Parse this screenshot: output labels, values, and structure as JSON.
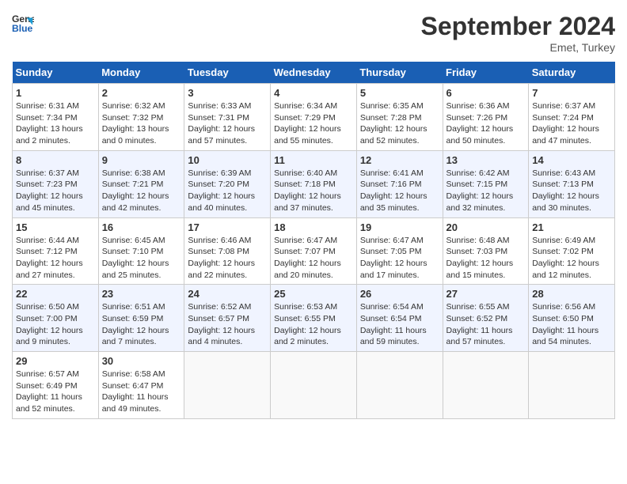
{
  "header": {
    "logo_line1": "General",
    "logo_line2": "Blue",
    "month": "September 2024",
    "location": "Emet, Turkey"
  },
  "weekdays": [
    "Sunday",
    "Monday",
    "Tuesday",
    "Wednesday",
    "Thursday",
    "Friday",
    "Saturday"
  ],
  "weeks": [
    [
      {
        "day": "1",
        "info": "Sunrise: 6:31 AM\nSunset: 7:34 PM\nDaylight: 13 hours\nand 2 minutes."
      },
      {
        "day": "2",
        "info": "Sunrise: 6:32 AM\nSunset: 7:32 PM\nDaylight: 13 hours\nand 0 minutes."
      },
      {
        "day": "3",
        "info": "Sunrise: 6:33 AM\nSunset: 7:31 PM\nDaylight: 12 hours\nand 57 minutes."
      },
      {
        "day": "4",
        "info": "Sunrise: 6:34 AM\nSunset: 7:29 PM\nDaylight: 12 hours\nand 55 minutes."
      },
      {
        "day": "5",
        "info": "Sunrise: 6:35 AM\nSunset: 7:28 PM\nDaylight: 12 hours\nand 52 minutes."
      },
      {
        "day": "6",
        "info": "Sunrise: 6:36 AM\nSunset: 7:26 PM\nDaylight: 12 hours\nand 50 minutes."
      },
      {
        "day": "7",
        "info": "Sunrise: 6:37 AM\nSunset: 7:24 PM\nDaylight: 12 hours\nand 47 minutes."
      }
    ],
    [
      {
        "day": "8",
        "info": "Sunrise: 6:37 AM\nSunset: 7:23 PM\nDaylight: 12 hours\nand 45 minutes."
      },
      {
        "day": "9",
        "info": "Sunrise: 6:38 AM\nSunset: 7:21 PM\nDaylight: 12 hours\nand 42 minutes."
      },
      {
        "day": "10",
        "info": "Sunrise: 6:39 AM\nSunset: 7:20 PM\nDaylight: 12 hours\nand 40 minutes."
      },
      {
        "day": "11",
        "info": "Sunrise: 6:40 AM\nSunset: 7:18 PM\nDaylight: 12 hours\nand 37 minutes."
      },
      {
        "day": "12",
        "info": "Sunrise: 6:41 AM\nSunset: 7:16 PM\nDaylight: 12 hours\nand 35 minutes."
      },
      {
        "day": "13",
        "info": "Sunrise: 6:42 AM\nSunset: 7:15 PM\nDaylight: 12 hours\nand 32 minutes."
      },
      {
        "day": "14",
        "info": "Sunrise: 6:43 AM\nSunset: 7:13 PM\nDaylight: 12 hours\nand 30 minutes."
      }
    ],
    [
      {
        "day": "15",
        "info": "Sunrise: 6:44 AM\nSunset: 7:12 PM\nDaylight: 12 hours\nand 27 minutes."
      },
      {
        "day": "16",
        "info": "Sunrise: 6:45 AM\nSunset: 7:10 PM\nDaylight: 12 hours\nand 25 minutes."
      },
      {
        "day": "17",
        "info": "Sunrise: 6:46 AM\nSunset: 7:08 PM\nDaylight: 12 hours\nand 22 minutes."
      },
      {
        "day": "18",
        "info": "Sunrise: 6:47 AM\nSunset: 7:07 PM\nDaylight: 12 hours\nand 20 minutes."
      },
      {
        "day": "19",
        "info": "Sunrise: 6:47 AM\nSunset: 7:05 PM\nDaylight: 12 hours\nand 17 minutes."
      },
      {
        "day": "20",
        "info": "Sunrise: 6:48 AM\nSunset: 7:03 PM\nDaylight: 12 hours\nand 15 minutes."
      },
      {
        "day": "21",
        "info": "Sunrise: 6:49 AM\nSunset: 7:02 PM\nDaylight: 12 hours\nand 12 minutes."
      }
    ],
    [
      {
        "day": "22",
        "info": "Sunrise: 6:50 AM\nSunset: 7:00 PM\nDaylight: 12 hours\nand 9 minutes."
      },
      {
        "day": "23",
        "info": "Sunrise: 6:51 AM\nSunset: 6:59 PM\nDaylight: 12 hours\nand 7 minutes."
      },
      {
        "day": "24",
        "info": "Sunrise: 6:52 AM\nSunset: 6:57 PM\nDaylight: 12 hours\nand 4 minutes."
      },
      {
        "day": "25",
        "info": "Sunrise: 6:53 AM\nSunset: 6:55 PM\nDaylight: 12 hours\nand 2 minutes."
      },
      {
        "day": "26",
        "info": "Sunrise: 6:54 AM\nSunset: 6:54 PM\nDaylight: 11 hours\nand 59 minutes."
      },
      {
        "day": "27",
        "info": "Sunrise: 6:55 AM\nSunset: 6:52 PM\nDaylight: 11 hours\nand 57 minutes."
      },
      {
        "day": "28",
        "info": "Sunrise: 6:56 AM\nSunset: 6:50 PM\nDaylight: 11 hours\nand 54 minutes."
      }
    ],
    [
      {
        "day": "29",
        "info": "Sunrise: 6:57 AM\nSunset: 6:49 PM\nDaylight: 11 hours\nand 52 minutes."
      },
      {
        "day": "30",
        "info": "Sunrise: 6:58 AM\nSunset: 6:47 PM\nDaylight: 11 hours\nand 49 minutes."
      },
      {
        "day": "",
        "info": ""
      },
      {
        "day": "",
        "info": ""
      },
      {
        "day": "",
        "info": ""
      },
      {
        "day": "",
        "info": ""
      },
      {
        "day": "",
        "info": ""
      }
    ]
  ]
}
